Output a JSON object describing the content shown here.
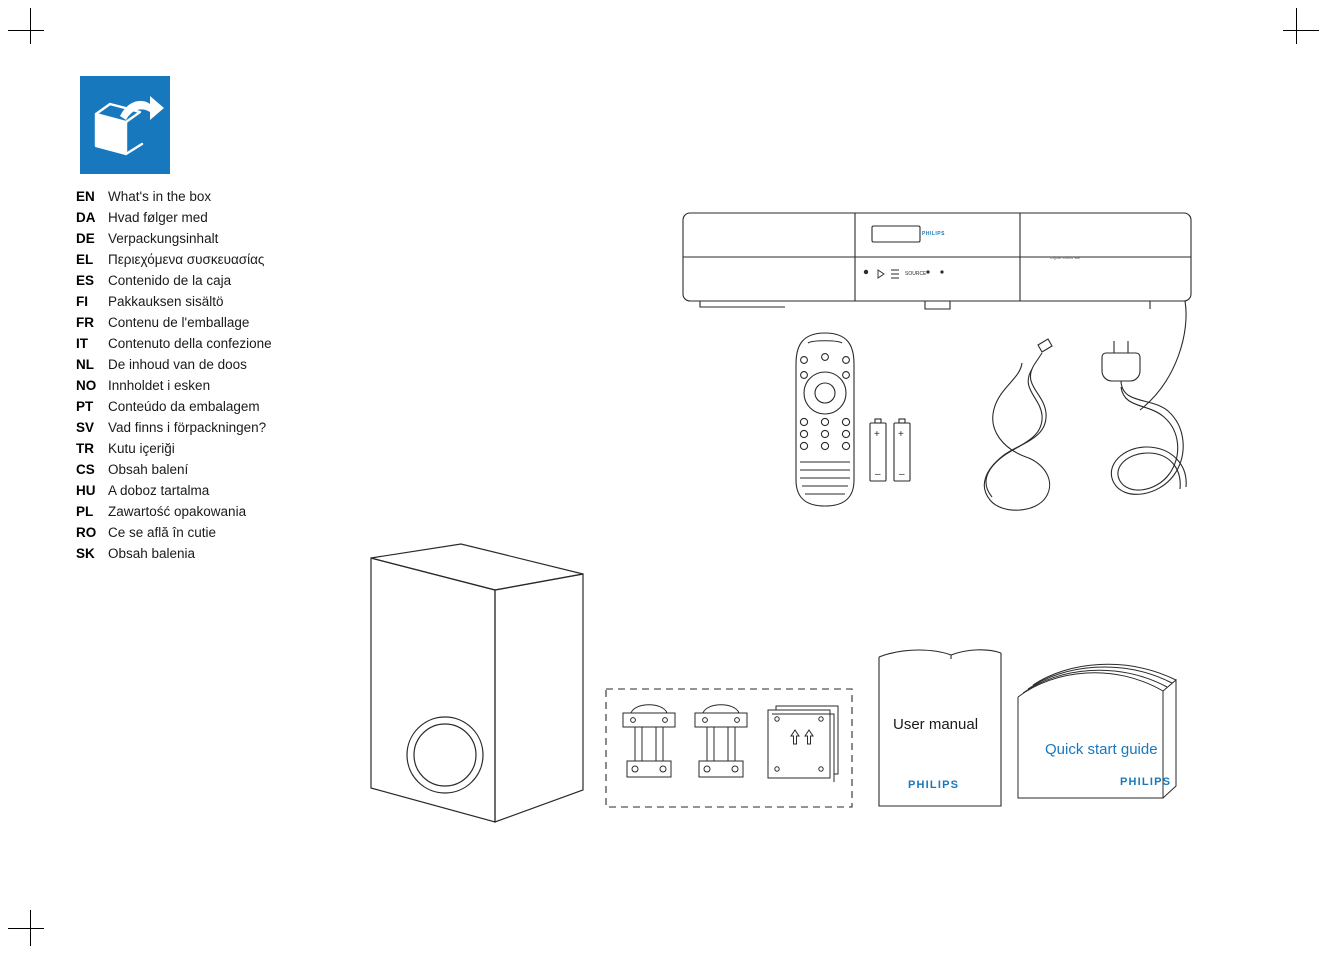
{
  "document": {
    "title": "What's in the box",
    "icon": "open-box-arrow-icon",
    "brand": "PHILIPS",
    "accent_color": "#1878be"
  },
  "languages": [
    {
      "code": "EN",
      "name": "What's in the box"
    },
    {
      "code": "DA",
      "name": "Hvad følger med"
    },
    {
      "code": "DE",
      "name": "Verpackungsinhalt"
    },
    {
      "code": "EL",
      "name": "Περιεχόμενα συσκευασίας"
    },
    {
      "code": "ES",
      "name": "Contenido de la caja"
    },
    {
      "code": "FI",
      "name": "Pakkauksen sisältö"
    },
    {
      "code": "FR",
      "name": "Contenu de l'emballage"
    },
    {
      "code": "IT",
      "name": "Contenuto della confezione"
    },
    {
      "code": "NL",
      "name": "De inhoud van de doos"
    },
    {
      "code": "NO",
      "name": "Innholdet i esken"
    },
    {
      "code": "PT",
      "name": "Conteúdo da embalagem"
    },
    {
      "code": "SV",
      "name": "Vad finns i förpackningen?"
    },
    {
      "code": "TR",
      "name": "Kutu içeriği"
    },
    {
      "code": "CS",
      "name": "Obsah balení"
    },
    {
      "code": "HU",
      "name": "A doboz tartalma"
    },
    {
      "code": "PL",
      "name": "Zawartość opakowania"
    },
    {
      "code": "RO",
      "name": "Ce se află în cutie"
    },
    {
      "code": "SK",
      "name": "Obsah balenia"
    }
  ],
  "items": {
    "soundbar": {
      "name": "soundbar-speaker",
      "brand_label": "PHILIPS",
      "right_label": "Digital Sound Bar"
    },
    "remote": {
      "name": "remote-control"
    },
    "batteries": {
      "name": "aaa-batteries",
      "plus": "+",
      "minus": "–"
    },
    "audio_cable": {
      "name": "audio-cable"
    },
    "power_cable": {
      "name": "power-cable"
    },
    "subwoofer": {
      "name": "subwoofer"
    },
    "brackets": {
      "name": "wall-mount-brackets-and-spacer"
    },
    "user_manual": {
      "title": "User manual",
      "brand": "PHILIPS"
    },
    "quick_start": {
      "title": "Quick start guide",
      "brand": "PHILIPS"
    }
  }
}
